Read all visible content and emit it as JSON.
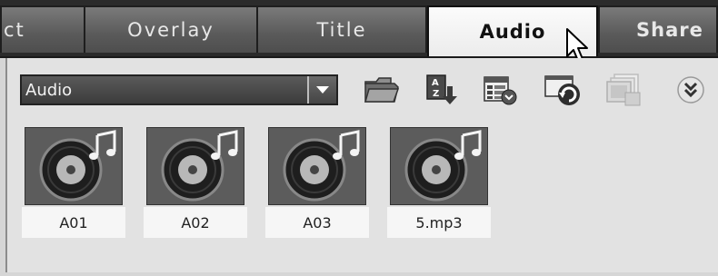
{
  "tabs": [
    {
      "label": "ct",
      "state": "inactive"
    },
    {
      "label": "Overlay",
      "state": "inactive"
    },
    {
      "label": "Title",
      "state": "inactive"
    },
    {
      "label": "Audio",
      "state": "active"
    },
    {
      "label": "Share",
      "state": "inactive"
    }
  ],
  "library": {
    "category_value": "Audio",
    "toolbar_icons": [
      "folder-open-icon",
      "sort-az-icon",
      "view-options-icon",
      "refresh-media-icon",
      "library-manager-icon",
      "more-options-icon"
    ]
  },
  "clips": [
    {
      "label": "A01",
      "icon": "audio-disc-icon"
    },
    {
      "label": "A02",
      "icon": "audio-disc-icon"
    },
    {
      "label": "A03",
      "icon": "audio-disc-icon"
    },
    {
      "label": "5.mp3",
      "icon": "audio-disc-icon"
    }
  ],
  "colors": {
    "tab_inactive": "#5a5a5a",
    "tab_active": "#f4f4f4",
    "panel": "#e2e2e2"
  }
}
